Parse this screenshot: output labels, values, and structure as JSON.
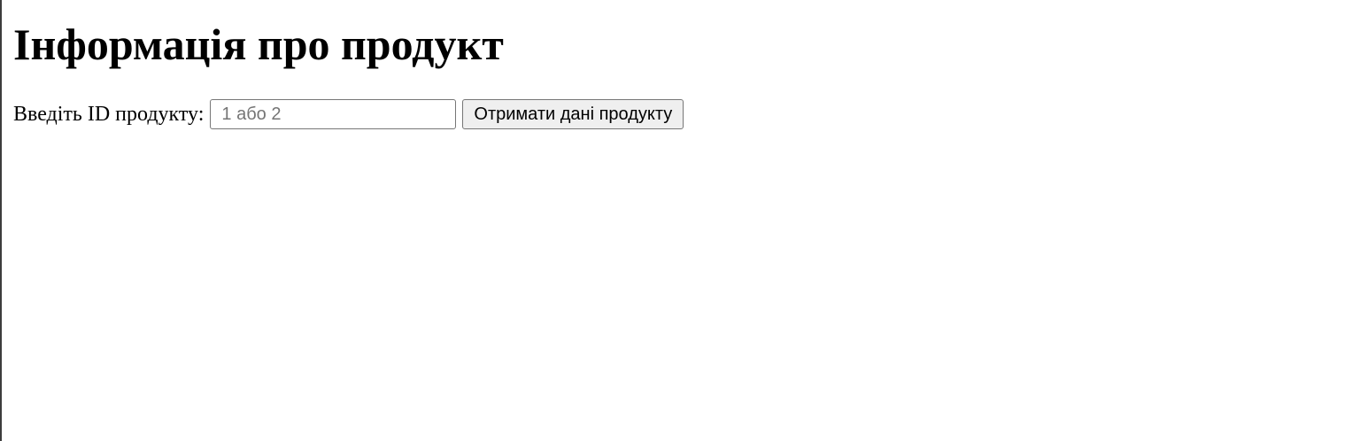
{
  "page": {
    "title": "Інформація про продукт"
  },
  "form": {
    "label": "Введіть ID продукту:",
    "input_value": "",
    "input_placeholder": "1 або 2",
    "submit_label": "Отримати дані продукту"
  }
}
